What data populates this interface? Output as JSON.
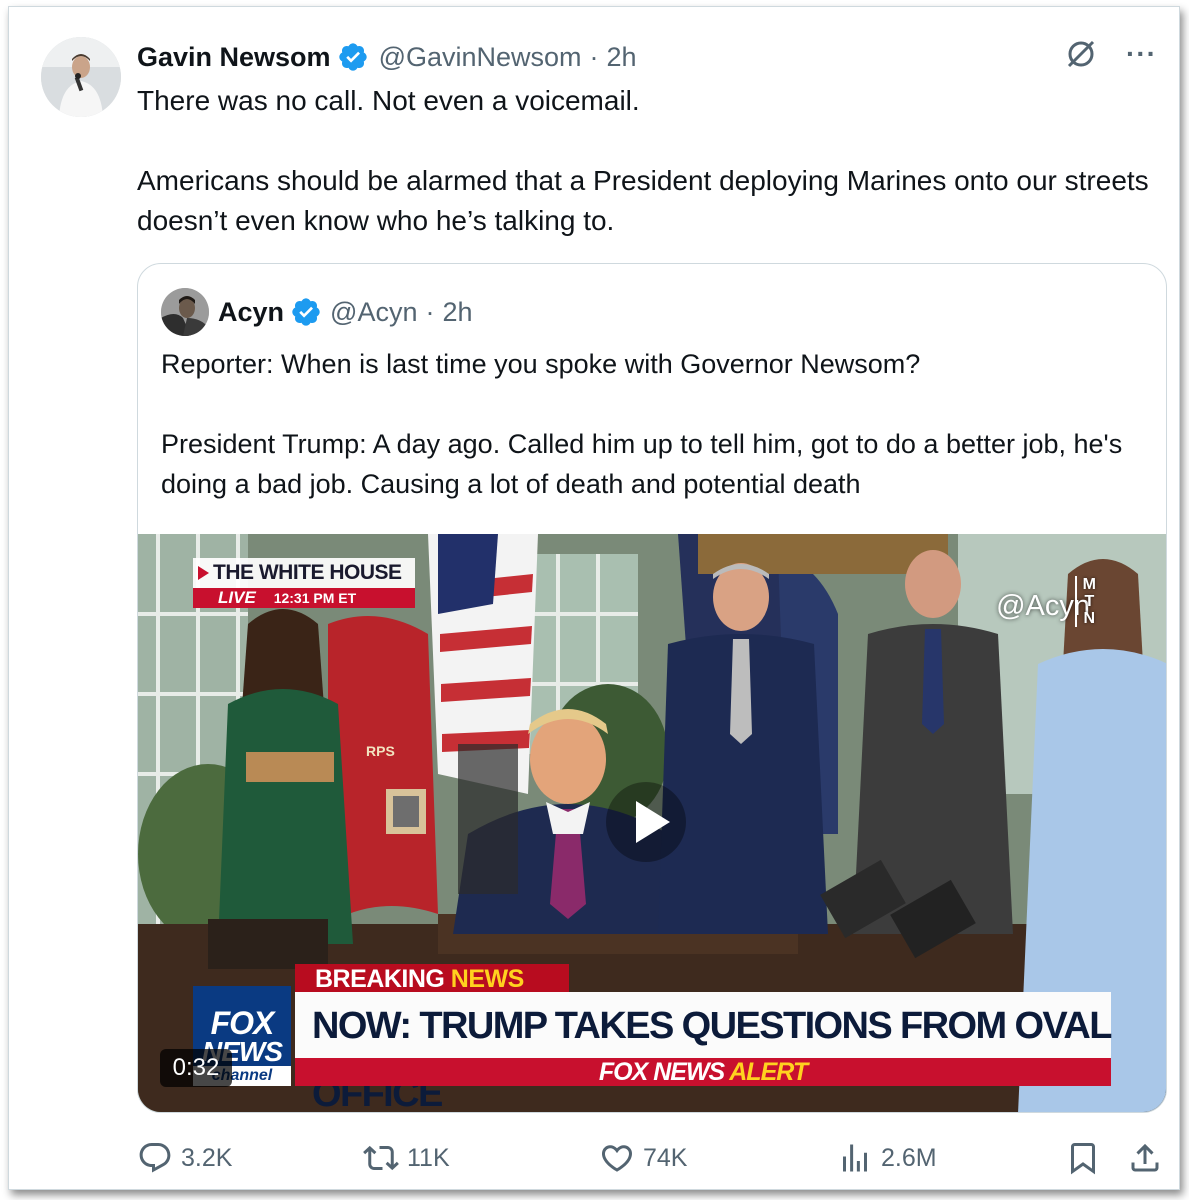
{
  "tweet": {
    "author_name": "Gavin Newsom",
    "author_handle": "@GavinNewsom",
    "separator": "·",
    "time": "2h",
    "more_label": "···",
    "text_line1": "There was no call. Not even a voicemail.",
    "text_line2": "Americans should be alarmed that a President deploying Marines onto our streets doesn’t even know who he’s talking to."
  },
  "quote": {
    "author_name": "Acyn",
    "author_handle": "@Acyn",
    "separator": "·",
    "time": "2h",
    "text_line1": "Reporter: When is last time you spoke with Governor Newsom?",
    "text_line2": "President Trump: A day ago. Called him up to tell him, got to do a better job, he's doing a bad job. Causing a lot of death and potential death"
  },
  "video": {
    "duration": "0:32",
    "overlay": {
      "location_title": "THE WHITE HOUSE",
      "live_label": "LIVE",
      "live_time": "12:31 PM ET",
      "watermark": "@Acyn",
      "mtn_line1": "M",
      "mtn_line2": "T",
      "mtn_line3": "N",
      "breaking_word": "BREAKING",
      "news_word": "NEWS",
      "headline": "NOW: TRUMP TAKES QUESTIONS FROM OVAL OFFICE",
      "alert_brand": "FOX NEWS",
      "alert_word": "ALERT",
      "logo_line1": "FOX",
      "logo_line2": "NEWS",
      "logo_line3": "channel",
      "flag_text": "RPS"
    }
  },
  "actions": {
    "replies": "3.2K",
    "reposts": "11K",
    "likes": "74K",
    "views": "2.6M"
  },
  "colors": {
    "verified_blue": "#1d9bf0",
    "secondary_text": "#536471",
    "primary_text": "#0f1419",
    "fox_red": "#c8102e",
    "fox_blue": "#0a3a82"
  },
  "icons": [
    "verified-badge-icon",
    "grok-icon",
    "more-icon",
    "play-icon",
    "reply-icon",
    "repost-icon",
    "like-icon",
    "views-icon",
    "bookmark-icon",
    "share-icon"
  ]
}
